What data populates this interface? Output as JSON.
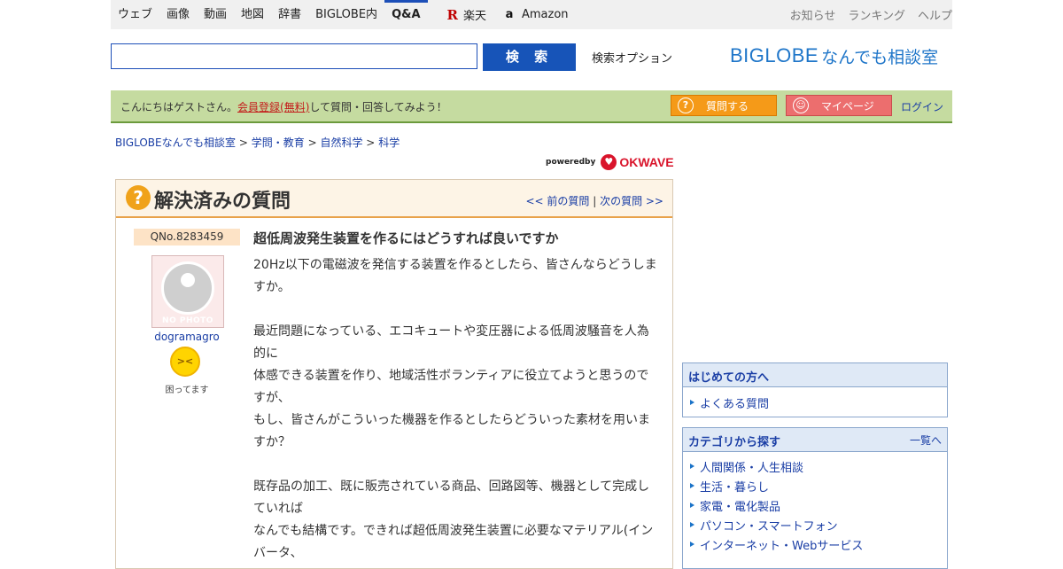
{
  "topnav": {
    "items": [
      {
        "label": "ウェブ"
      },
      {
        "label": "画像"
      },
      {
        "label": "動画"
      },
      {
        "label": "地図"
      },
      {
        "label": "辞書"
      },
      {
        "label": "BIGLOBE内"
      },
      {
        "label": "Q&A",
        "active": true
      }
    ],
    "rakuten_label": "楽天",
    "amazon_label": "Amazon",
    "right_links": [
      {
        "label": "お知らせ"
      },
      {
        "label": "ランキング"
      },
      {
        "label": "ヘルプ"
      }
    ]
  },
  "search": {
    "value": "",
    "button_label": "検 索",
    "options_label": "検索オプション"
  },
  "brand": {
    "logo_text": "BIGLOBE",
    "service_name": "なんでも相談室"
  },
  "guestbar": {
    "greeting": "こんにちはゲストさん。",
    "register_link": "会員登録(無料)",
    "greeting_suffix": "して質問・回答してみよう！",
    "ask_button": "質問する",
    "mypage_button": "マイページ",
    "login_link": "ログイン"
  },
  "breadcrumb": {
    "items": [
      {
        "label": "BIGLOBEなんでも相談室"
      },
      {
        "label": "学問・教育"
      },
      {
        "label": "自然科学"
      },
      {
        "label": "科学"
      }
    ],
    "separator": ">"
  },
  "powered": {
    "prefix": "poweredby",
    "name": "OKWAVE"
  },
  "question": {
    "header_title": "解決済みの質問",
    "prev_link": "<< 前の質問",
    "next_link": "次の質問 >>",
    "number": "QNo.8283459",
    "avatar_text": "NO PHOTO",
    "username": "dogramagro",
    "mood_label": "困ってます",
    "title": "超低周波発生装置を作るにはどうすれば良いですか",
    "body_lines": [
      "20Hz以下の電磁波を発信する装置を作るとしたら、皆さんならどうしま",
      "すか。",
      "",
      "最近問題になっている、エコキュートや変圧器による低周波騒音を人為",
      "的に",
      "体感できる装置を作り、地域活性ボランティアに役立てようと思うので",
      "すが、",
      "もし、皆さんがこういった機器を作るとしたらどういった素材を用いま",
      "すか？",
      "",
      "既存品の加工、既に販売されている商品、回路図等、機器として完成し",
      "ていれば",
      "なんでも結構です。できれば超低周波発生装置に必要なマテリアル(イン",
      "バータ、"
    ]
  },
  "sidebar": {
    "beginners": {
      "title": "はじめての方へ",
      "items": [
        {
          "label": "よくある質問"
        }
      ]
    },
    "categories": {
      "title": "カテゴリから探す",
      "more_link": "一覧へ",
      "items": [
        {
          "label": "人間関係・人生相談"
        },
        {
          "label": "生活・暮らし"
        },
        {
          "label": "家電・電化製品"
        },
        {
          "label": "パソコン・スマートフォン"
        },
        {
          "label": "インターネット・Webサービス"
        }
      ]
    }
  }
}
